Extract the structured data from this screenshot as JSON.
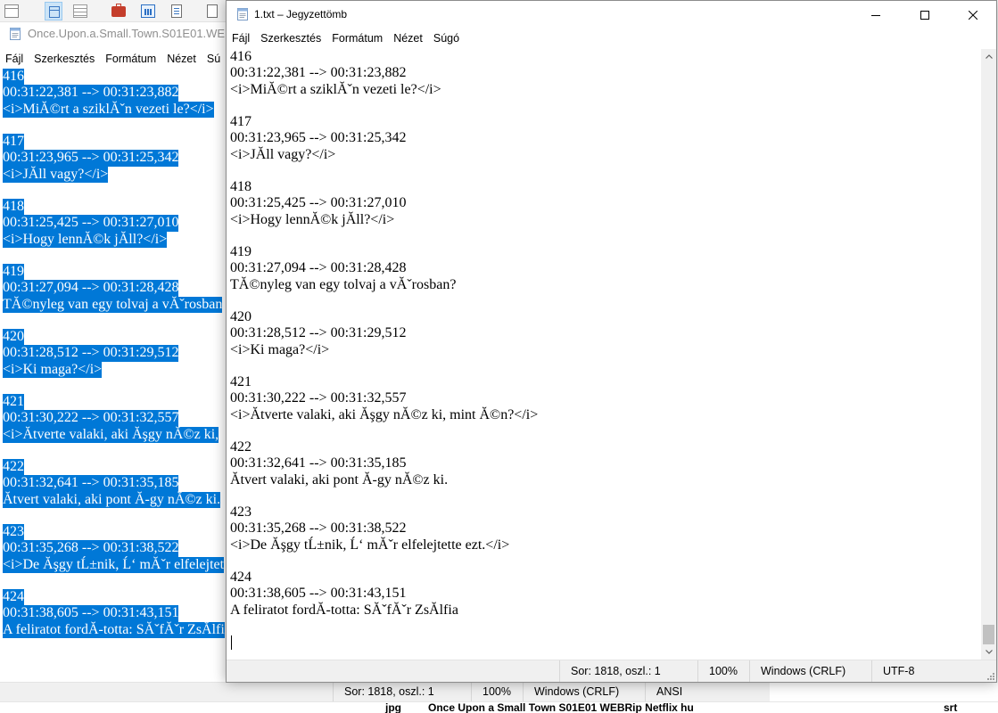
{
  "ribbon": {
    "icons": [
      "window-icon",
      "layout-icon",
      "list-icon",
      "briefcase-icon",
      "chart-icon",
      "document-icon",
      "page-icon"
    ]
  },
  "colors": {
    "selection": "#0078d7",
    "selection_text": "#ffffff",
    "status_bar": "#f0f0f0"
  },
  "background_window": {
    "title": "Once.Upon.a.Small.Town.S01E01.WEB",
    "menu": [
      "Fájl",
      "Szerkesztés",
      "Formátum",
      "Nézet",
      "Sú"
    ],
    "selected_lines": [
      "416",
      "00:31:22,381 --> 00:31:23,882",
      "<i>MiĂ©rt a sziklĂˇn vezeti le?</i>",
      "",
      "417",
      "00:31:23,965 --> 00:31:25,342",
      "<i>JĂll vagy?</i>",
      "",
      "418",
      "00:31:25,425 --> 00:31:27,010",
      "<i>Hogy lennĂ©k jĂll?</i>",
      "",
      "419",
      "00:31:27,094 --> 00:31:28,428",
      "TĂ©nyleg van egy tolvaj a vĂˇrosban",
      "",
      "420",
      "00:31:28,512 --> 00:31:29,512",
      "<i>Ki maga?</i>",
      "",
      "421",
      "00:31:30,222 --> 00:31:32,557",
      "<i>Ătverte valaki, aki Ăşgy nĂ©z ki,",
      "",
      "422",
      "00:31:32,641 --> 00:31:35,185",
      "Ătvert valaki, aki pont Ă-gy nĂ©z ki.",
      "",
      "423",
      "00:31:35,268 --> 00:31:38,522",
      "<i>De Ăşgy tĹ±nik, Ĺ‘ mĂˇr elfelejtet",
      "",
      "424",
      "00:31:38,605 --> 00:31:43,151",
      "A feliratot fordĂ-totta: SĂˇfĂˇr ZsĂlfi"
    ],
    "status": {
      "position": "Sor: 1818, oszl.: 1",
      "zoom": "100%",
      "line_ending": "Windows (CRLF)",
      "encoding": "ANSI"
    }
  },
  "foreground_window": {
    "title": "1.txt – Jegyzettömb",
    "menu": [
      "Fájl",
      "Szerkesztés",
      "Formátum",
      "Nézet",
      "Súgó"
    ],
    "lines": [
      "416",
      "00:31:22,381 --> 00:31:23,882",
      "<i>MiĂ©rt a sziklĂˇn vezeti le?</i>",
      "",
      "417",
      "00:31:23,965 --> 00:31:25,342",
      "<i>JĂll vagy?</i>",
      "",
      "418",
      "00:31:25,425 --> 00:31:27,010",
      "<i>Hogy lennĂ©k jĂll?</i>",
      "",
      "419",
      "00:31:27,094 --> 00:31:28,428",
      "TĂ©nyleg van egy tolvaj a vĂˇrosban?",
      "",
      "420",
      "00:31:28,512 --> 00:31:29,512",
      "<i>Ki maga?</i>",
      "",
      "421",
      "00:31:30,222 --> 00:31:32,557",
      "<i>Ătverte valaki, aki Ăşgy nĂ©z ki, mint Ă©n?</i>",
      "",
      "422",
      "00:31:32,641 --> 00:31:35,185",
      "Ătvert valaki, aki pont Ă-gy nĂ©z ki.",
      "",
      "423",
      "00:31:35,268 --> 00:31:38,522",
      "<i>De Ăşgy tĹ±nik, Ĺ‘ mĂˇr elfelejtette ezt.</i>",
      "",
      "424",
      "00:31:38,605 --> 00:31:43,151",
      "A feliratot fordĂ-totta: SĂˇfĂˇr ZsĂlfia",
      "",
      ""
    ],
    "scroll_percent": 100,
    "status": {
      "position": "Sor: 1818, oszl.: 1",
      "zoom": "100%",
      "line_ending": "Windows (CRLF)",
      "encoding": "UTF-8"
    }
  },
  "file_row": {
    "extension": "jpg",
    "name": "Once Upon a Small Town S01E01 WEBRip Netflix hu",
    "type": "srt"
  }
}
